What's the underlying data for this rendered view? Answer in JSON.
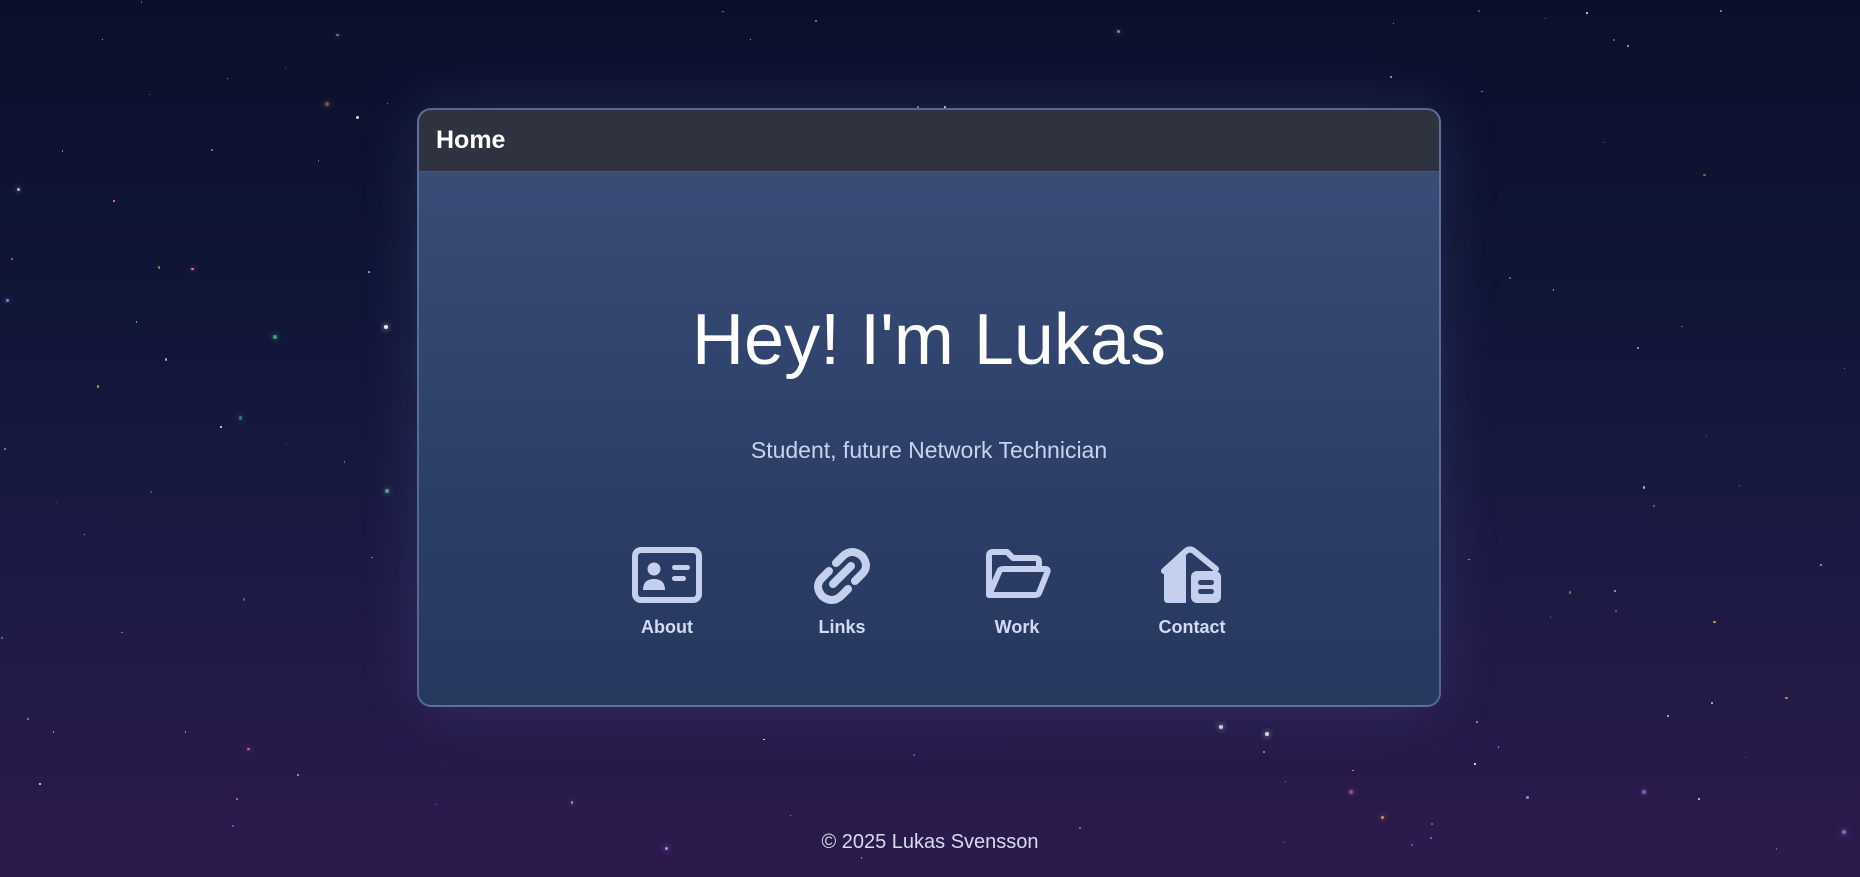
{
  "window": {
    "title": "Home"
  },
  "hero": {
    "title": "Hey! I'm Lukas",
    "subtitle": "Student, future Network Technician"
  },
  "nav": {
    "items": [
      {
        "label": "About",
        "icon": "id-card-icon"
      },
      {
        "label": "Links",
        "icon": "link-icon"
      },
      {
        "label": "Work",
        "icon": "folder-open-icon"
      },
      {
        "label": "Contact",
        "icon": "mailbox-icon"
      }
    ]
  },
  "footer": {
    "text": "© 2025 Lukas Svensson"
  },
  "colors": {
    "icon": "#c5d0ee",
    "accent_window": "#33466f",
    "titlebar": "#2f323f"
  }
}
